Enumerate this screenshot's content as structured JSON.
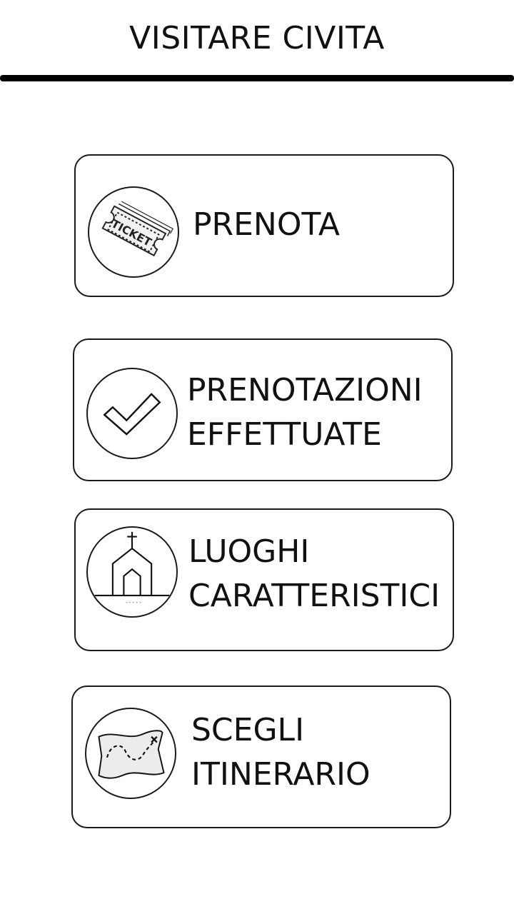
{
  "header": {
    "title": "VISITARE CIVITA"
  },
  "menu": {
    "items": [
      {
        "id": "prenota",
        "lines": [
          "PRENOTA"
        ],
        "icon": "ticket-icon"
      },
      {
        "id": "prenotazioni-effettuate",
        "lines": [
          "PRENOTAZIONI",
          "EFFETTUATE"
        ],
        "icon": "checkmark-icon"
      },
      {
        "id": "luoghi-caratteristici",
        "lines": [
          "LUOGHI",
          "CARATTERISTICI"
        ],
        "icon": "church-icon"
      },
      {
        "id": "scegli-itinerario",
        "lines": [
          "SCEGLI",
          "ITINERARIO"
        ],
        "icon": "treasure-map-icon"
      }
    ],
    "ticket_icon_text": "TICKET"
  },
  "colors": {
    "background": "#ffffff",
    "foreground": "#111111",
    "border": "#1a1a1a"
  }
}
